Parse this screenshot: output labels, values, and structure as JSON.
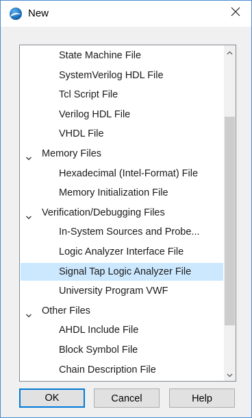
{
  "window": {
    "title": "New",
    "title_icon": "app-logo-icon",
    "close_icon": "close-icon"
  },
  "list": {
    "items": [
      {
        "type": "child",
        "label": "State Machine File"
      },
      {
        "type": "child",
        "label": "SystemVerilog HDL File"
      },
      {
        "type": "child",
        "label": "Tcl Script File"
      },
      {
        "type": "child",
        "label": "Verilog HDL File"
      },
      {
        "type": "child",
        "label": "VHDL File"
      },
      {
        "type": "group",
        "label": "Memory Files"
      },
      {
        "type": "child",
        "label": "Hexadecimal (Intel-Format) File"
      },
      {
        "type": "child",
        "label": "Memory Initialization File"
      },
      {
        "type": "group",
        "label": "Verification/Debugging Files"
      },
      {
        "type": "child",
        "label": "In-System Sources and Probe..."
      },
      {
        "type": "child",
        "label": "Logic Analyzer Interface File"
      },
      {
        "type": "child",
        "label": "Signal Tap Logic Analyzer File",
        "selected": true
      },
      {
        "type": "child",
        "label": "University Program VWF"
      },
      {
        "type": "group",
        "label": "Other Files"
      },
      {
        "type": "child",
        "label": "AHDL Include File"
      },
      {
        "type": "child",
        "label": "Block Symbol File"
      },
      {
        "type": "child",
        "label": "Chain Description File"
      }
    ],
    "selected_color": "#cce8ff"
  },
  "buttons": {
    "ok": "OK",
    "cancel": "Cancel",
    "help": "Help"
  },
  "colors": {
    "accent": "#0078d7",
    "window_border": "#4a8ccf"
  }
}
